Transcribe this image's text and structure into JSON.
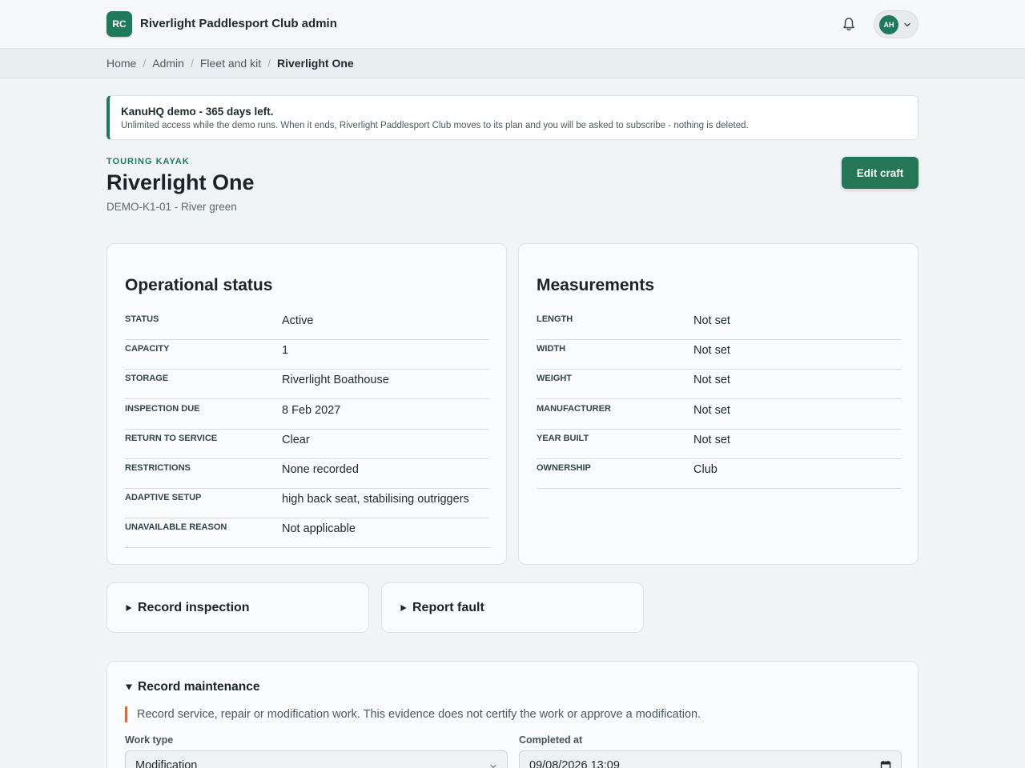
{
  "app": {
    "badge": "RC",
    "title": "Riverlight Paddlesport Club admin"
  },
  "user": {
    "initials": "AH"
  },
  "breadcrumb": {
    "items": [
      "Home",
      "Admin",
      "Fleet and kit"
    ],
    "current": "Riverlight One",
    "separator": "/"
  },
  "notice": {
    "title": "KanuHQ demo - 365 days left.",
    "body": "Unlimited access while the demo runs. When it ends, Riverlight Paddlesport Club moves to its plan and you will be asked to subscribe - nothing is deleted."
  },
  "craft": {
    "eyebrow": "TOURING KAYAK",
    "name": "Riverlight One",
    "subtitle": "DEMO-K1-01 - River green",
    "edit_label": "Edit craft"
  },
  "operational": {
    "title": "Operational status",
    "rows": [
      {
        "k": "STATUS",
        "v": "Active"
      },
      {
        "k": "CAPACITY",
        "v": "1"
      },
      {
        "k": "STORAGE",
        "v": "Riverlight Boathouse"
      },
      {
        "k": "INSPECTION DUE",
        "v": "8 Feb 2027"
      },
      {
        "k": "RETURN TO SERVICE",
        "v": "Clear"
      },
      {
        "k": "RESTRICTIONS",
        "v": "None recorded"
      },
      {
        "k": "ADAPTIVE SETUP",
        "v": "high back seat, stabilising outriggers"
      },
      {
        "k": "UNAVAILABLE REASON",
        "v": "Not applicable"
      }
    ]
  },
  "measurements": {
    "title": "Measurements",
    "rows": [
      {
        "k": "LENGTH",
        "v": "Not set"
      },
      {
        "k": "WIDTH",
        "v": "Not set"
      },
      {
        "k": "WEIGHT",
        "v": "Not set"
      },
      {
        "k": "MANUFACTURER",
        "v": "Not set"
      },
      {
        "k": "YEAR BUILT",
        "v": "Not set"
      },
      {
        "k": "OWNERSHIP",
        "v": "Club"
      }
    ]
  },
  "actions": {
    "inspection_label": "Record inspection",
    "fault_label": "Report fault"
  },
  "maintenance": {
    "title": "Record maintenance",
    "note": "Record service, repair or modification work. This evidence does not certify the work or approve a modification.",
    "work_type_label": "Work type",
    "work_type_value": "Modification",
    "completed_label": "Completed at",
    "completed_value": "09/08/2026 13:09"
  },
  "colors": {
    "brand": "#1f7a5c",
    "accent_note": "#e06a2c"
  }
}
